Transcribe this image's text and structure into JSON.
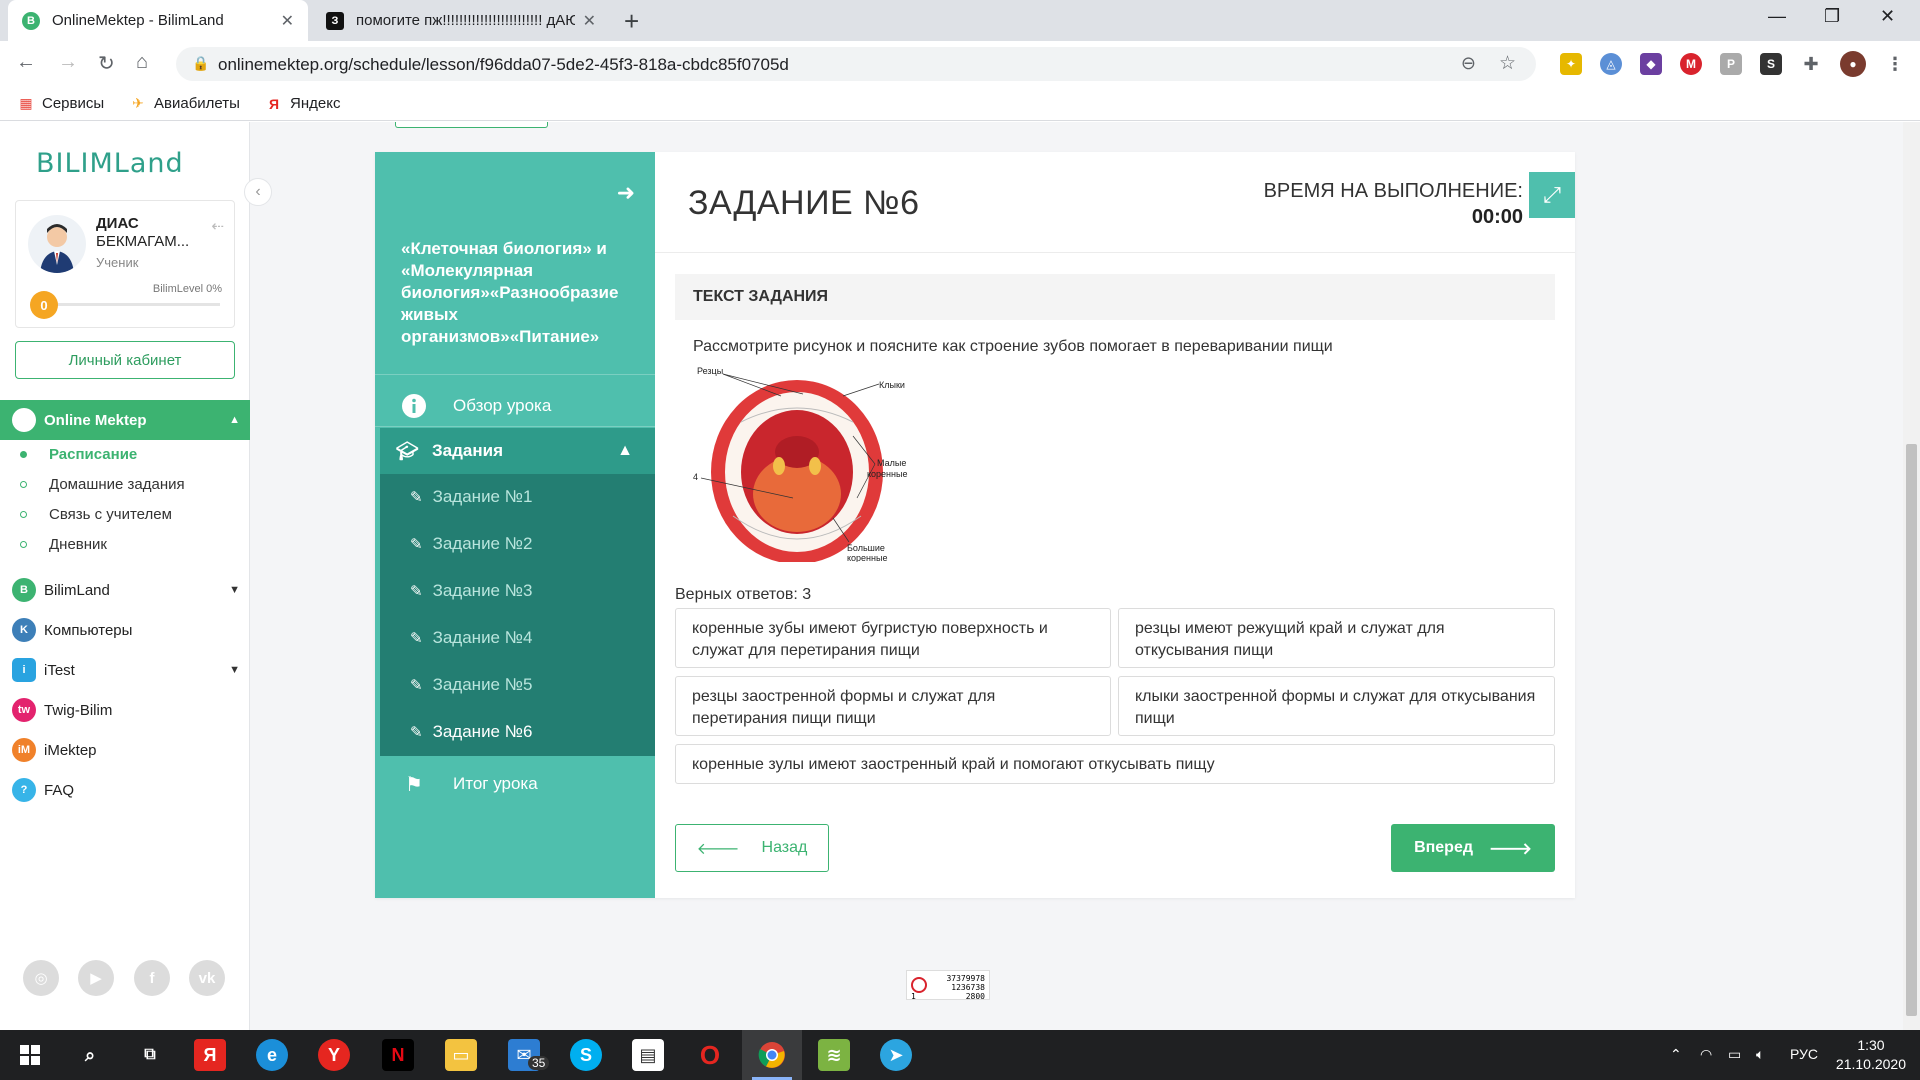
{
  "browser": {
    "tabs": [
      {
        "title": "OnlineMektep - BilimLand",
        "favicon": "B"
      },
      {
        "title": "помогите пж!!!!!!!!!!!!!!!!!!!!!!!! дАЮ",
        "favicon": "З"
      }
    ],
    "url": "onlinemektep.org/schedule/lesson/f96dda07-5de2-45f3-818a-cbdc85f0705d",
    "bookmarks": [
      "Сервисы",
      "Авиабилеты",
      "Яндекс"
    ]
  },
  "sidebar": {
    "logo": "BILIMLand",
    "profile": {
      "first_name": "ДИАС",
      "last_name": "БЕКМАГАМ...",
      "role": "Ученик",
      "level_label": "BilimLevel 0%",
      "level_value": "0",
      "level_fraction": 0
    },
    "cabinet_label": "Личный кабинет",
    "section": "Online Mektep",
    "subitems": [
      "Расписание",
      "Домашние задания",
      "Связь с учителем",
      "Дневник"
    ],
    "items": [
      "BilimLand",
      "Компьютеры",
      "iTest",
      "Twig-Bilim",
      "iMektep",
      "FAQ"
    ]
  },
  "lesson": {
    "title": "«Клеточная биология» и «Молекулярная биология»«Разнообразие живых организмов»«Питание»",
    "overview": "Обзор урока",
    "tasks_label": "Задания",
    "tasks": [
      "Задание №1",
      "Задание №2",
      "Задание №3",
      "Задание №4",
      "Задание №5",
      "Задание №6"
    ],
    "summary": "Итог урока"
  },
  "task": {
    "title": "ЗАДАНИЕ №6",
    "timer_label": "ВРЕМЯ НА ВЫПОЛНЕНИЕ:",
    "timer_value": "00:00",
    "text_header": "ТЕКСТ ЗАДАНИЯ",
    "question": "Рассмотрите рисунок и поясните как строение зубов помогает в переваривании пищи",
    "figure_labels": {
      "incisors": "Резцы",
      "canines": "Клыки",
      "premolars_1": "Малые",
      "premolars_2": "коренные",
      "molars_1": "Большие",
      "molars_2": "коренные",
      "num": "4"
    },
    "answers_label": "Верных ответов: 3",
    "answers": [
      "коренные зубы имеют бугристую поверхность и служат для перетирания пищи",
      "резцы имеют режущий край и служат для откусывания пищи",
      "резцы заостренной формы и служат для перетирания пищи пищи",
      "клыки заостренной формы и служат для откусывания пищи",
      "коренные зулы имеют заостренный край и помогают откусывать пищу"
    ],
    "back_label": "Назад",
    "next_label": "Вперед"
  },
  "counter": {
    "line1": "37379978",
    "line2": "1236738",
    "line3a": "1",
    "line3b": "2800"
  },
  "taskbar": {
    "mail_badge": "35",
    "lang": "РУС",
    "time": "1:30",
    "date": "21.10.2020"
  },
  "colors": {
    "accent": "#3cb371",
    "teal": "#4fbfad",
    "teal_dark": "#237e72"
  }
}
